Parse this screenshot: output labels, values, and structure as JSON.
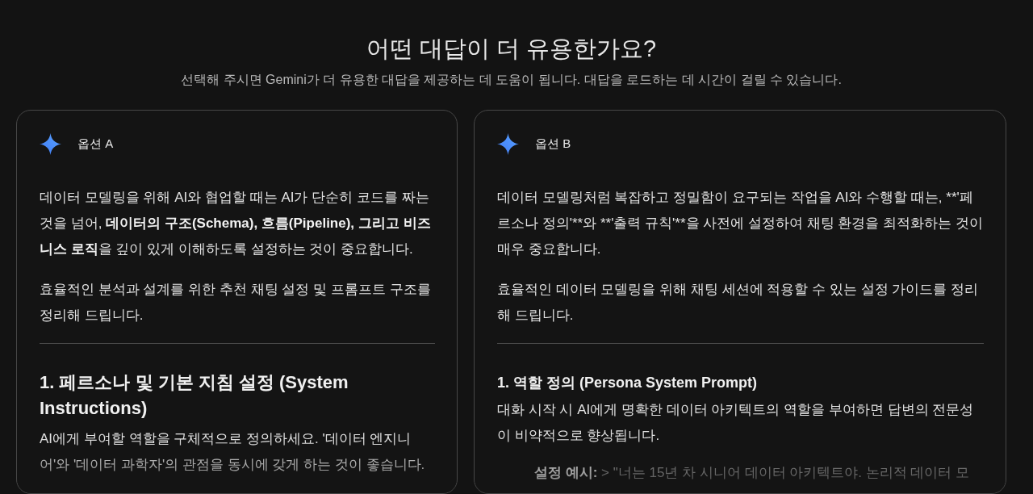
{
  "header": {
    "title": "어떤 대답이 더 유용한가요?",
    "subtitle": "선택해 주시면 Gemini가 더 유용한 대답을 제공하는 데 도움이 됩니다. 대답을 로드하는 데 시간이 걸릴 수 있습니다."
  },
  "options": [
    {
      "label": "옵션 A",
      "blocks": [
        {
          "kind": "paragraph",
          "text": "데이터 모델링을 위해 AI와 협업할 때는 AI가 단순히 코드를 짜는 것을 넘어, **데이터의 구조(Schema), 흐름(Pipeline), 그리고 비즈니스 로직**을 깊이 있게 이해하도록 설정하는 것이 중요합니다."
        },
        {
          "kind": "paragraph",
          "text": "효율적인 분석과 설계를 위한 추천 채팅 설정 및 프롬프트 구조를 정리해 드립니다."
        },
        {
          "kind": "divider"
        },
        {
          "kind": "heading_large",
          "text": "1. 페르소나 및 기본 지침 설정 (System Instructions)"
        },
        {
          "kind": "paragraph_tight",
          "text": "AI에게 부여할 역할을 구체적으로 정의하세요. '데이터 엔지니어'와 '데이터 과학자'의 관점을 동시에 갖게 하는 것이 좋습니다."
        }
      ]
    },
    {
      "label": "옵션 B",
      "blocks": [
        {
          "kind": "plain_paragraph",
          "text": "데이터 모델링처럼 복잡하고 정밀함이 요구되는 작업을 AI와 수행할 때는, **'페르소나 정의'**와 **'출력 규칙'**을 사전에 설정하여 채팅 환경을 최적화하는 것이 매우 중요합니다."
        },
        {
          "kind": "paragraph",
          "text": "효율적인 데이터 모델링을 위해 채팅 세션에 적용할 수 있는 설정 가이드를 정리해 드립니다."
        },
        {
          "kind": "divider"
        },
        {
          "kind": "heading_small",
          "text": "1. 역할 정의 (Persona System Prompt)"
        },
        {
          "kind": "paragraph_tight",
          "text": "대화 시작 시 AI에게 명확한 데이터 아키텍트의 역할을 부여하면 답변의 전문성이 비약적으로 향상됩니다."
        },
        {
          "kind": "quote",
          "text": "**설정 예시:** > \"너는 15년 차 시니어 데이터 아키텍트야. 논리적 데이터 모"
        }
      ]
    }
  ]
}
